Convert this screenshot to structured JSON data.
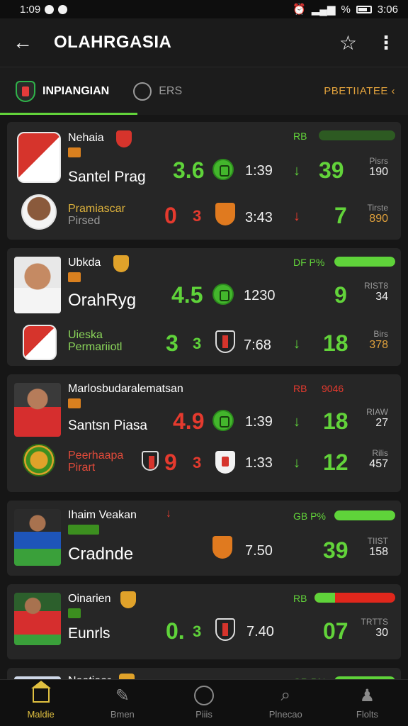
{
  "status_bar": {
    "time": "1:09",
    "right_text": "%",
    "clock": "3:06"
  },
  "app_bar": {
    "title": "OLAHRGASIA"
  },
  "tabs": [
    {
      "label": "INPIANGIAN"
    },
    {
      "label": "ERS"
    }
  ],
  "tab_right_label": "PBETIIATEE ‹",
  "matches": [
    {
      "top_name": "Nehaia",
      "badge": "",
      "team1": "Santel Prag",
      "score1": "3.6",
      "time1": "1:39",
      "num1": "39",
      "stat1_label": "Pisrs",
      "stat1_value": "190",
      "bar_label": "RB",
      "bar_fill": 1.0,
      "team2_line1": "Pramiascar",
      "team2_line2": "Pirsed",
      "score2a": "0",
      "score2b": "3",
      "time2": "3:43",
      "num2": "7",
      "stat2_label": "Tirste",
      "stat2_value": "890"
    },
    {
      "top_name": "Ubkda",
      "badge": "",
      "team1": "OrahRyg",
      "score1": "4.5",
      "time1": "1230",
      "num1": "9",
      "stat1_label": "RIST8",
      "stat1_value": "34",
      "bar_label": "DF P%",
      "bar_fill": 1.0,
      "team2_line1": "Uieska",
      "team2_line2": "Permariiotl",
      "score2a": "3",
      "score2b": "3",
      "time2": "7:68",
      "num2": "18",
      "stat2_label": "Birs",
      "stat2_value": "378"
    },
    {
      "top_name": "Marlosbudaralematsan",
      "badge": "",
      "team1": "Santsn Piasa",
      "score1": "4.9",
      "time1": "1:39",
      "num1": "18",
      "stat1_label": "RIAW",
      "stat1_value": "27",
      "bar_label": "RB",
      "bar_value": "9046",
      "team2_line1": "Peerhaapa",
      "team2_line2": "Pirart",
      "score2a": "9",
      "score2b": "3",
      "time2": "1:33",
      "num2": "12",
      "stat2_label": "Rilis",
      "stat2_value": "457"
    },
    {
      "top_name": "Ihaim Veakan",
      "badge": "",
      "team1": "Cradnde",
      "time1": "7.50",
      "num1": "39",
      "stat1_label": "TIIST",
      "stat1_value": "158",
      "bar_label": "GB P%",
      "bar_fill": 1.0
    },
    {
      "top_name": "Oinarien",
      "badge": "",
      "team1": "Eunrls",
      "score1": "0.",
      "score1b": "3",
      "time1": "7.40",
      "num1": "07",
      "stat1_label": "TRTTS",
      "stat1_value": "30",
      "bar_label": "RB",
      "bar_fill": 0.25
    },
    {
      "top_name": "Neatiaar",
      "badge": "",
      "bar_label": "GR P%",
      "bar_fill": 1.0
    }
  ],
  "bottom_nav": [
    {
      "label": "Maldie",
      "icon": "home-icon"
    },
    {
      "label": "Bmen",
      "icon": "edit-icon"
    },
    {
      "label": "Piiis",
      "icon": "team-icon"
    },
    {
      "label": "Plnecao",
      "icon": "search-icon"
    },
    {
      "label": "Flolts",
      "icon": "profile-icon"
    }
  ],
  "colors": {
    "accent_green": "#5fd33a",
    "accent_red": "#e53a2e",
    "accent_gold": "#e0a13c",
    "background": "#161616"
  }
}
